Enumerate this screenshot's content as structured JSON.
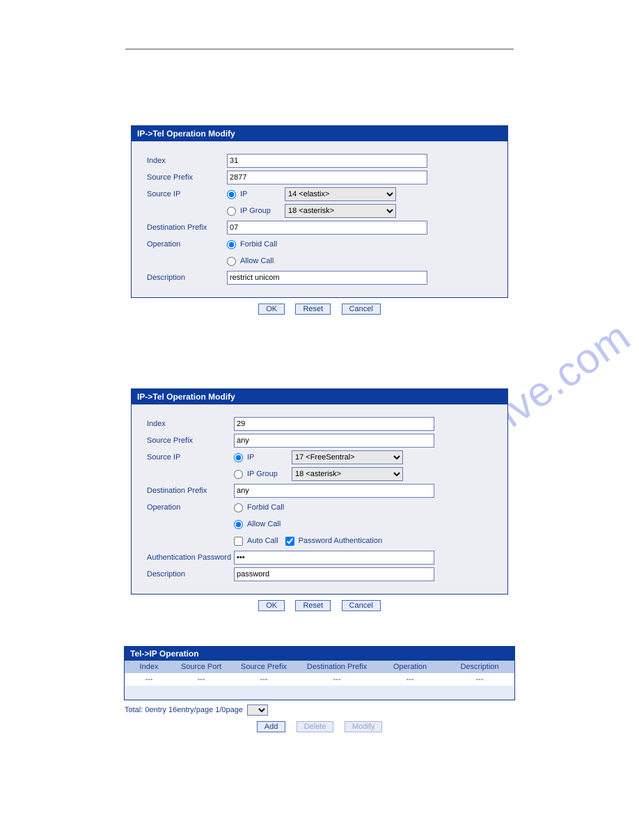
{
  "watermark_text": "manualshive.com",
  "buttons": {
    "ok": "OK",
    "reset": "Reset",
    "cancel": "Cancel",
    "add": "Add",
    "delete": "Delete",
    "modify": "Modify"
  },
  "common_labels": {
    "index": "Index",
    "source_prefix": "Source Prefix",
    "source_ip": "Source IP",
    "ip": "IP",
    "ip_group": "IP Group",
    "destination_prefix": "Destination Prefix",
    "operation": "Operation",
    "forbid_call": "Forbid Call",
    "allow_call": "Allow Call",
    "auto_call": "Auto Call",
    "password_auth": "Password Authentication",
    "auth_password": "Authentication Password",
    "description": "Description"
  },
  "panel1": {
    "title": "IP->Tel Operation Modify",
    "index": "31",
    "source_prefix": "2877",
    "ip_selected": "14 <elastix>",
    "ipgroup_selected": "18 <asterisk>",
    "destination_prefix": "07",
    "description": "restrict unicom",
    "radio_ip_checked": true,
    "radio_forbid_checked": true
  },
  "panel2": {
    "title": "IP->Tel Operation Modify",
    "index": "29",
    "source_prefix": "any",
    "ip_selected": "17 <FreeSentral>",
    "ipgroup_selected": "18 <asterisk>",
    "destination_prefix": "any",
    "auth_password": "•••",
    "description": "password",
    "radio_ip_checked": true,
    "radio_allow_checked": true,
    "chk_password_auth": true
  },
  "table": {
    "title": "Tel->IP Operation",
    "columns": {
      "index": "Index",
      "source_port": "Source Port",
      "source_prefix": "Source Prefix",
      "destination_prefix": "Destination Prefix",
      "operation": "Operation",
      "description": "Description"
    },
    "row_placeholder": "---",
    "pager": "Total: 0entry  16entry/page  1/0page"
  }
}
